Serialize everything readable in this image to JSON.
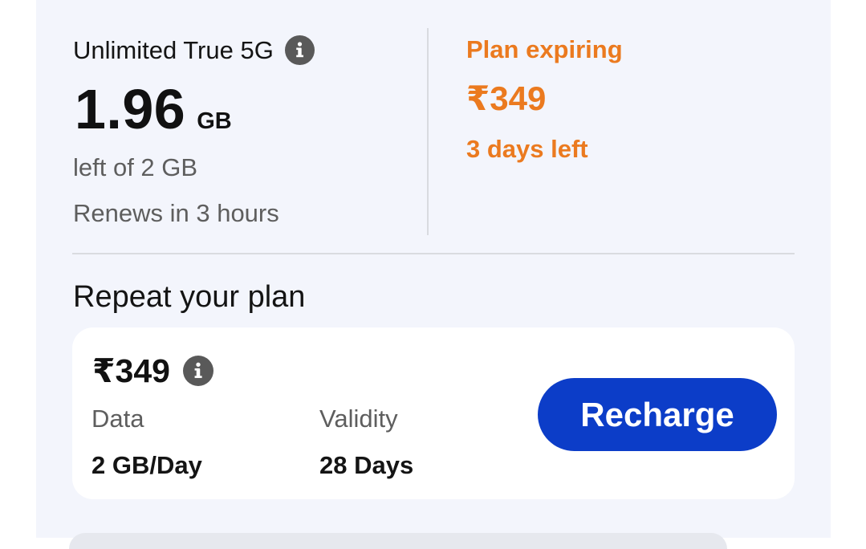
{
  "current_plan": {
    "name": "Unlimited True 5G",
    "info_icon": "info-icon",
    "data_remaining": "1.96",
    "data_unit": "GB",
    "data_total_text": "left of 2 GB",
    "renew_text": "Renews in 3 hours"
  },
  "expiry": {
    "title": "Plan expiring",
    "price": "₹349",
    "days_left": "3 days left"
  },
  "repeat_plan": {
    "heading": "Repeat your plan",
    "price": "₹349",
    "info_icon": "info-icon",
    "data_label": "Data",
    "data_value": "2 GB/Day",
    "validity_label": "Validity",
    "validity_value": "28 Days",
    "button_label": "Recharge"
  },
  "colors": {
    "accent_orange": "#eb7a1f",
    "button_blue": "#0c3dc8",
    "panel_bg": "#f3f5fc"
  }
}
